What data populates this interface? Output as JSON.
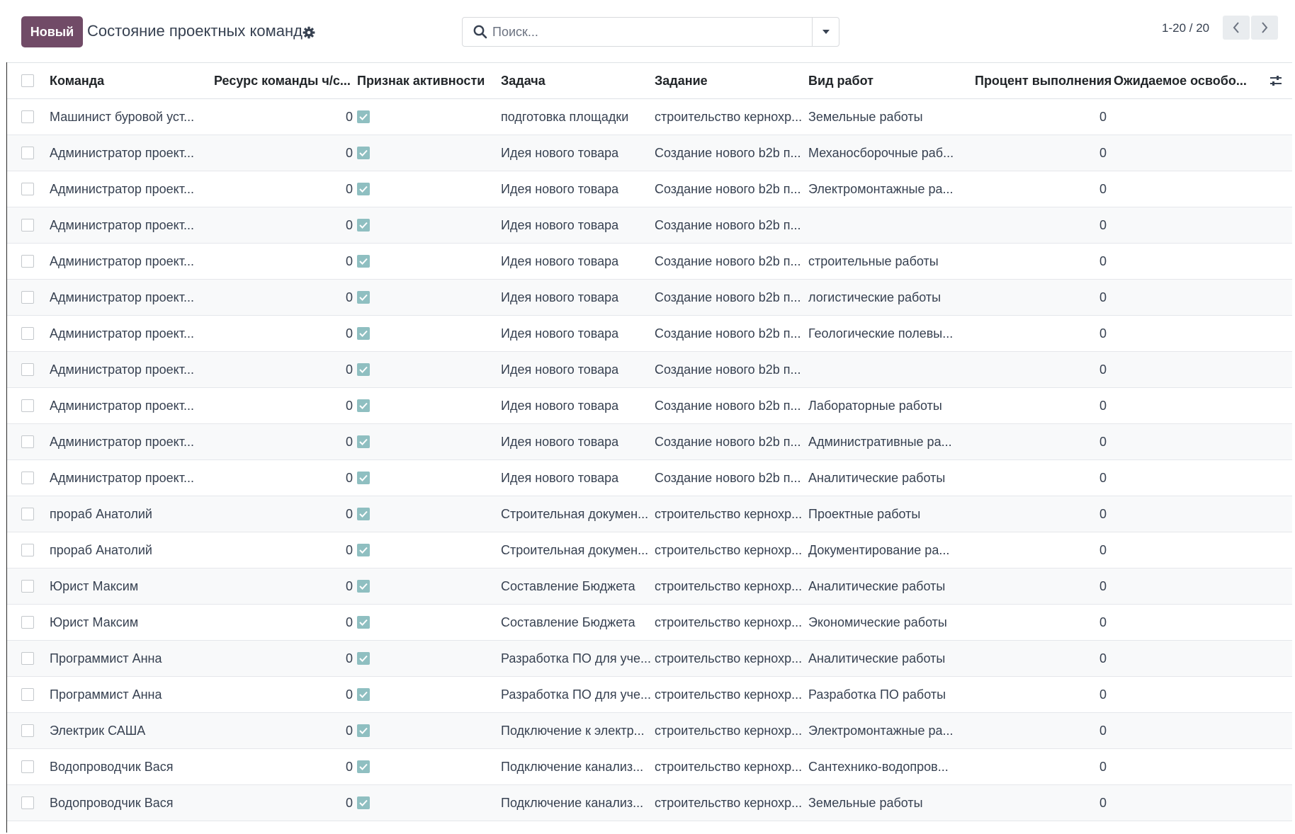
{
  "control_panel": {
    "new_button": "Новый",
    "title": "Состояние проектных команд",
    "search_placeholder": "Поиск...",
    "pager_value": "1-20 / 20"
  },
  "table": {
    "columns": {
      "team": "Команда",
      "resource": "Ресурс команды ч/с...",
      "active": "Признак активности",
      "task": "Задача",
      "job": "Задание",
      "work_type": "Вид работ",
      "percent": "Процент выполнения",
      "expected": "Ожидаемое освобо..."
    },
    "rows": [
      {
        "team": "Машинист буровой уст...",
        "resource": "0",
        "active": true,
        "task": "подготовка площадки",
        "job": "строительство кернохр...",
        "work_type": "Земельные работы",
        "percent": "0",
        "expected": ""
      },
      {
        "team": "Администратор проект...",
        "resource": "0",
        "active": true,
        "task": "Идея нового товара",
        "job": "Создание нового b2b п...",
        "work_type": "Механосборочные раб...",
        "percent": "0",
        "expected": ""
      },
      {
        "team": "Администратор проект...",
        "resource": "0",
        "active": true,
        "task": "Идея нового товара",
        "job": "Создание нового b2b п...",
        "work_type": "Электромонтажные ра...",
        "percent": "0",
        "expected": ""
      },
      {
        "team": "Администратор проект...",
        "resource": "0",
        "active": true,
        "task": "Идея нового товара",
        "job": "Создание нового b2b п...",
        "work_type": "",
        "percent": "0",
        "expected": ""
      },
      {
        "team": "Администратор проект...",
        "resource": "0",
        "active": true,
        "task": "Идея нового товара",
        "job": "Создание нового b2b п...",
        "work_type": "строительные работы",
        "percent": "0",
        "expected": ""
      },
      {
        "team": "Администратор проект...",
        "resource": "0",
        "active": true,
        "task": "Идея нового товара",
        "job": "Создание нового b2b п...",
        "work_type": "логистические работы",
        "percent": "0",
        "expected": ""
      },
      {
        "team": "Администратор проект...",
        "resource": "0",
        "active": true,
        "task": "Идея нового товара",
        "job": "Создание нового b2b п...",
        "work_type": "Геологические полевы...",
        "percent": "0",
        "expected": ""
      },
      {
        "team": "Администратор проект...",
        "resource": "0",
        "active": true,
        "task": "Идея нового товара",
        "job": "Создание нового b2b п...",
        "work_type": "",
        "percent": "0",
        "expected": ""
      },
      {
        "team": "Администратор проект...",
        "resource": "0",
        "active": true,
        "task": "Идея нового товара",
        "job": "Создание нового b2b п...",
        "work_type": "Лабораторные работы",
        "percent": "0",
        "expected": ""
      },
      {
        "team": "Администратор проект...",
        "resource": "0",
        "active": true,
        "task": "Идея нового товара",
        "job": "Создание нового b2b п...",
        "work_type": "Административные ра...",
        "percent": "0",
        "expected": ""
      },
      {
        "team": "Администратор проект...",
        "resource": "0",
        "active": true,
        "task": "Идея нового товара",
        "job": "Создание нового b2b п...",
        "work_type": "Аналитические работы",
        "percent": "0",
        "expected": ""
      },
      {
        "team": "прораб Анатолий",
        "resource": "0",
        "active": true,
        "task": "Строительная докумен...",
        "job": "строительство кернохр...",
        "work_type": "Проектные работы",
        "percent": "0",
        "expected": ""
      },
      {
        "team": "прораб Анатолий",
        "resource": "0",
        "active": true,
        "task": "Строительная докумен...",
        "job": "строительство кернохр...",
        "work_type": "Документирование ра...",
        "percent": "0",
        "expected": ""
      },
      {
        "team": "Юрист Максим",
        "resource": "0",
        "active": true,
        "task": "Составление Бюджета",
        "job": "строительство кернохр...",
        "work_type": "Аналитические работы",
        "percent": "0",
        "expected": ""
      },
      {
        "team": "Юрист Максим",
        "resource": "0",
        "active": true,
        "task": "Составление Бюджета",
        "job": "строительство кернохр...",
        "work_type": "Экономические работы",
        "percent": "0",
        "expected": ""
      },
      {
        "team": "Программист Анна",
        "resource": "0",
        "active": true,
        "task": "Разработка ПО для уче...",
        "job": "строительство кернохр...",
        "work_type": "Аналитические работы",
        "percent": "0",
        "expected": ""
      },
      {
        "team": "Программист Анна",
        "resource": "0",
        "active": true,
        "task": "Разработка ПО для уче...",
        "job": "строительство кернохр...",
        "work_type": "Разработка ПО работы",
        "percent": "0",
        "expected": ""
      },
      {
        "team": "Электрик САША",
        "resource": "0",
        "active": true,
        "task": "Подключение к электр...",
        "job": "строительство кернохр...",
        "work_type": "Электромонтажные ра...",
        "percent": "0",
        "expected": ""
      },
      {
        "team": "Водопроводчик Вася",
        "resource": "0",
        "active": true,
        "task": "Подключение канализ...",
        "job": "строительство кернохр...",
        "work_type": "Сантехнико-водопров...",
        "percent": "0",
        "expected": ""
      },
      {
        "team": "Водопроводчик Вася",
        "resource": "0",
        "active": true,
        "task": "Подключение канализ...",
        "job": "строительство кернохр...",
        "work_type": "Земельные работы",
        "percent": "0",
        "expected": ""
      }
    ]
  },
  "colors": {
    "primary": "#714B67",
    "checkbox_active": "#8fbfc1"
  },
  "icons": {
    "settings": "gear-icon",
    "search": "search-icon",
    "search_toggle": "caret-down-icon",
    "pager_prev": "chevron-left-icon",
    "pager_next": "chevron-right-icon",
    "optional_columns": "sliders-icon",
    "active_check": "check-icon"
  }
}
